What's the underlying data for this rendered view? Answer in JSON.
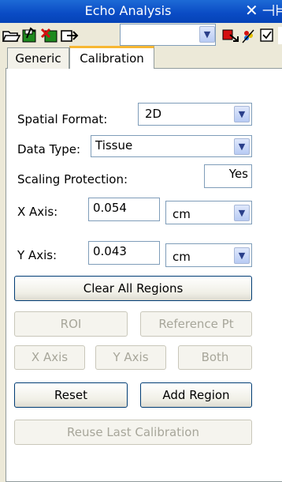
{
  "window": {
    "title": "Echo Analysis"
  },
  "titlebar_glyphs": {
    "close": "✕",
    "pin": "⊣⊨"
  },
  "toolbar": {
    "icons": [
      "open-folder-icon",
      "save-disk-icon",
      "delete-disk-icon",
      "export-icon",
      "red-arrow-icon",
      "color-palette-icon",
      "checkbox-icon"
    ],
    "combo_value": ""
  },
  "tabs": [
    {
      "label": "Generic",
      "active": false
    },
    {
      "label": "Calibration",
      "active": true
    }
  ],
  "form": {
    "spatial_format": {
      "label": "Spatial Format:",
      "value": "2D"
    },
    "data_type": {
      "label": "Data Type:",
      "value": "Tissue"
    },
    "scaling_protection": {
      "label": "Scaling Protection:",
      "value": "Yes"
    },
    "x_axis": {
      "label": "X Axis:",
      "value": "0.054",
      "unit": "cm"
    },
    "y_axis": {
      "label": "Y Axis:",
      "value": "0.043",
      "unit": "cm"
    }
  },
  "buttons": {
    "clear_all_regions": "Clear All Regions",
    "roi": "ROI",
    "reference_pt": "Reference Pt",
    "x_axis": "X Axis",
    "y_axis": "Y Axis",
    "both": "Both",
    "reset": "Reset",
    "add_region": "Add Region",
    "reuse_last_calibration": "Reuse Last Calibration"
  }
}
